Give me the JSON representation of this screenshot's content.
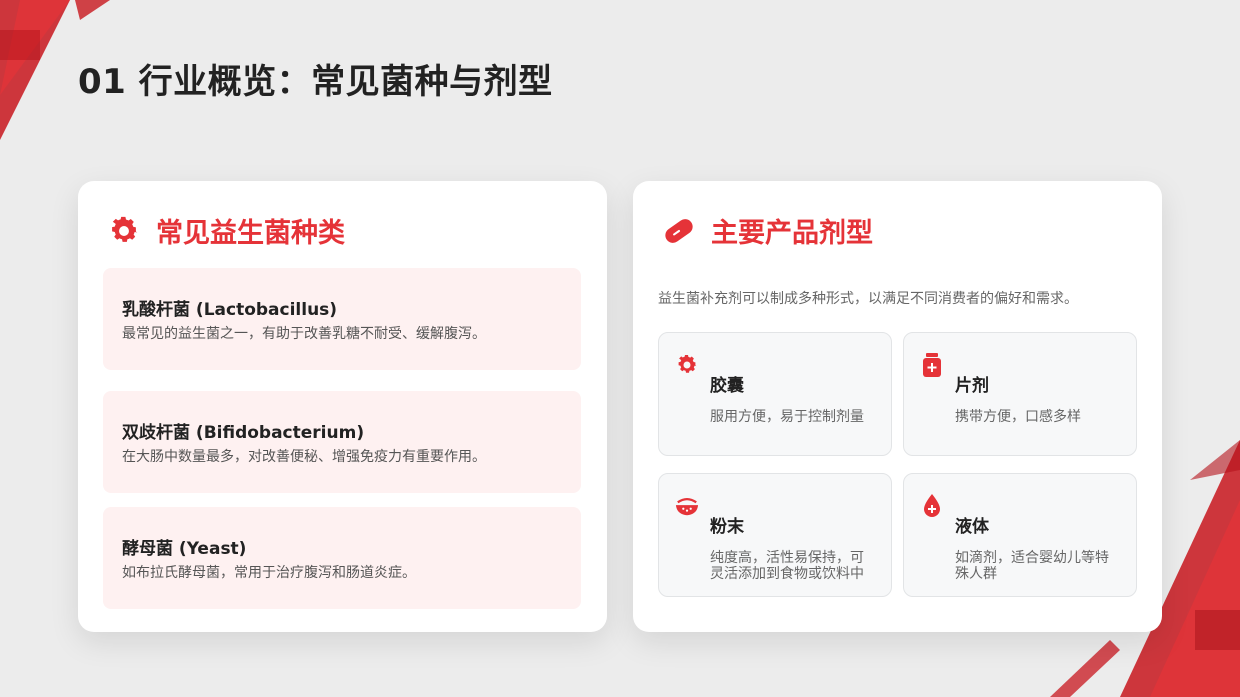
{
  "page_title": "01 行业概览：常见菌种与剂型",
  "left_card": {
    "title": "常见益生菌种类",
    "items": [
      {
        "name": "乳酸杆菌 (Lactobacillus)",
        "desc": "最常见的益生菌之一，有助于改善乳糖不耐受、缓解腹泻。"
      },
      {
        "name": "双歧杆菌 (Bifidobacterium)",
        "desc": "在大肠中数量最多，对改善便秘、增强免疫力有重要作用。"
      },
      {
        "name": "酵母菌 (Yeast)",
        "desc": "如布拉氏酵母菌，常用于治疗腹泻和肠道炎症。"
      }
    ]
  },
  "right_card": {
    "title": "主要产品剂型",
    "intro": "益生菌补充剂可以制成多种形式，以满足不同消费者的偏好和需求。",
    "forms": [
      {
        "name": "胶囊",
        "desc": "服用方便，易于控制剂量",
        "icon": "gear-icon"
      },
      {
        "name": "片剂",
        "desc": "携带方便，口感多样",
        "icon": "medicine-bottle-icon"
      },
      {
        "name": "粉末",
        "desc": "纯度高，活性易保持，可灵活添加到食物或饮料中",
        "icon": "bowl-icon"
      },
      {
        "name": "液体",
        "desc": "如滴剂，适合婴幼儿等特殊人群",
        "icon": "droplet-icon"
      }
    ]
  },
  "colors": {
    "accent": "#e53338",
    "item_bg": "#fef1f1"
  }
}
